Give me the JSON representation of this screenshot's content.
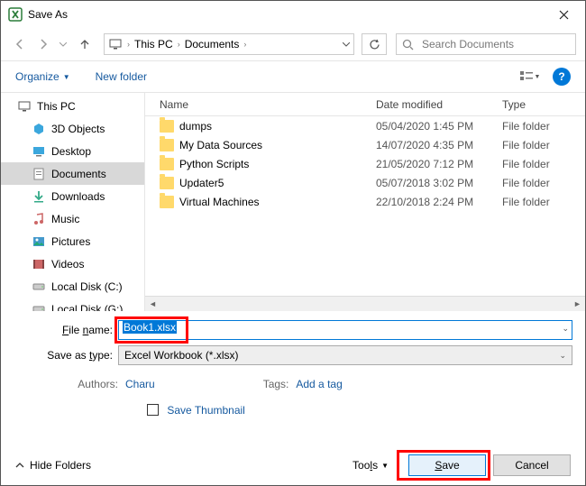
{
  "dialog": {
    "title": "Save As"
  },
  "breadcrumb": {
    "root": "This PC",
    "folder": "Documents"
  },
  "search": {
    "placeholder": "Search Documents"
  },
  "toolbar": {
    "organize": "Organize",
    "newfolder": "New folder"
  },
  "columns": {
    "name": "Name",
    "date": "Date modified",
    "type": "Type"
  },
  "tree": {
    "root": "This PC",
    "items": [
      "3D Objects",
      "Desktop",
      "Documents",
      "Downloads",
      "Music",
      "Pictures",
      "Videos",
      "Local Disk (C:)",
      "Local Disk (G:)"
    ]
  },
  "files": [
    {
      "name": "dumps",
      "date": "05/04/2020 1:45 PM",
      "type": "File folder"
    },
    {
      "name": "My Data Sources",
      "date": "14/07/2020 4:35 PM",
      "type": "File folder"
    },
    {
      "name": "Python Scripts",
      "date": "21/05/2020 7:12 PM",
      "type": "File folder"
    },
    {
      "name": "Updater5",
      "date": "05/07/2018 3:02 PM",
      "type": "File folder"
    },
    {
      "name": "Virtual Machines",
      "date": "22/10/2018 2:24 PM",
      "type": "File folder"
    }
  ],
  "form": {
    "filename_label": "File name:",
    "filename_value": "Book1.xlsx",
    "type_label": "Save as type:",
    "type_value": "Excel Workbook (*.xlsx)",
    "authors_label": "Authors:",
    "authors_value": "Charu",
    "tags_label": "Tags:",
    "tags_value": "Add a tag",
    "thumbnail_label": "Save Thumbnail"
  },
  "footer": {
    "hide": "Hide Folders",
    "tools": "Tools",
    "save": "Save",
    "cancel": "Cancel"
  }
}
